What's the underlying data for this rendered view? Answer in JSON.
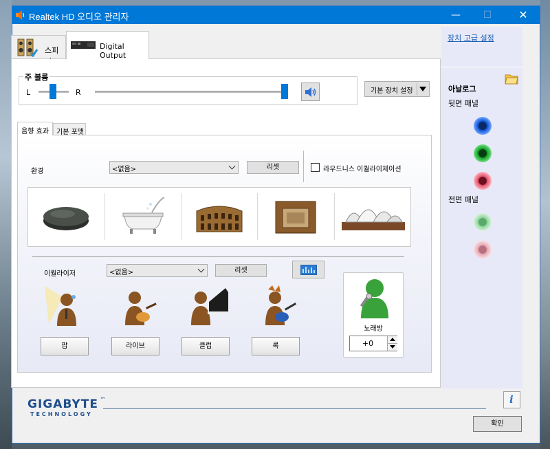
{
  "window": {
    "title": "Realtek HD 오디오 관리자",
    "minimize": "—",
    "maximize": "☐",
    "close": "✕"
  },
  "tabs": [
    {
      "label": "스피커",
      "icon": "speaker-icon",
      "active": false
    },
    {
      "label": "Digital Output",
      "icon": "digital-output-device-icon",
      "active": true
    }
  ],
  "volume": {
    "group_label": "주 볼륨",
    "left_label": "L",
    "right_label": "R",
    "balance": 0.5,
    "level": 1.0
  },
  "default_device_button": "기본 장치 설정",
  "inner_tabs": [
    {
      "label": "음향 효과",
      "active": true
    },
    {
      "label": "기본 포맷",
      "active": false
    }
  ],
  "environment": {
    "label": "환경",
    "value": "<없음>",
    "reset_label": "리셋",
    "loudness_label": "라우드니스 이퀄라이제이션",
    "loudness_checked": false,
    "presets": [
      "stone-disc-icon",
      "bathtub-icon",
      "colosseum-icon",
      "arena-icon",
      "opera-house-icon"
    ]
  },
  "equalizer": {
    "label": "이퀄라이저",
    "value": "<없음>",
    "reset_label": "리셋",
    "genres": [
      {
        "label": "팝",
        "icon": "pop-singer-icon"
      },
      {
        "label": "라이브",
        "icon": "live-guitarist-icon"
      },
      {
        "label": "클럽",
        "icon": "pianist-icon"
      },
      {
        "label": "록",
        "icon": "rock-guitarist-icon"
      }
    ]
  },
  "karaoke": {
    "label": "노래방",
    "value": "+0"
  },
  "right_panel": {
    "advanced_link": "장치 고급 설정",
    "analog_label": "아날로그",
    "rear_label": "뒷면 패널",
    "front_label": "전면 패널",
    "rear_jacks": [
      "#0c4fd1",
      "#0f9a24",
      "#e0506a"
    ],
    "front_jacks": [
      "#8fd49c",
      "#e6a7b2"
    ]
  },
  "brand": {
    "name": "GIGABYTE",
    "tm": "™",
    "sub": "TECHNOLOGY"
  },
  "ok_button": "확인"
}
